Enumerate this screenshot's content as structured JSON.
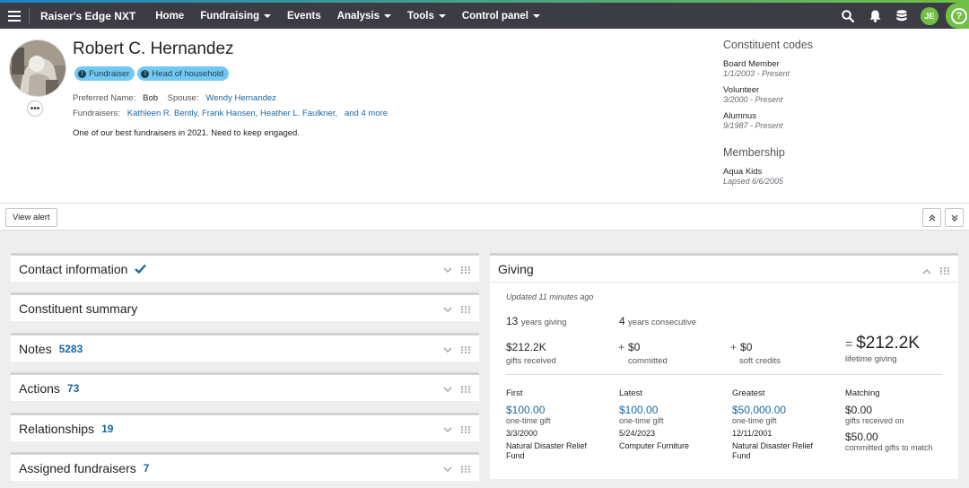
{
  "topbar": {
    "brand": "Raiser's Edge NXT",
    "nav": [
      {
        "label": "Home",
        "dropdown": false
      },
      {
        "label": "Fundraising",
        "dropdown": true
      },
      {
        "label": "Events",
        "dropdown": false
      },
      {
        "label": "Analysis",
        "dropdown": true
      },
      {
        "label": "Tools",
        "dropdown": true
      },
      {
        "label": "Control panel",
        "dropdown": true
      }
    ],
    "user_initials": "JE",
    "help_symbol": "?",
    "accent_colors": {
      "blue": "#1c84c6",
      "green": "#71bf44"
    }
  },
  "profile": {
    "name": "Robert C. Hernandez",
    "badges": [
      "Fundraiser",
      "Head of household"
    ],
    "preferred_name_label": "Preferred Name:",
    "preferred_name": "Bob",
    "spouse_label": "Spouse:",
    "spouse": "Wendy Hernandez",
    "fundraisers_label": "Fundraisers:",
    "fundraisers": [
      "Kathleen R. Bently,",
      "Frank Hansen,",
      "Heather L. Faulkner,",
      "and 4 more"
    ],
    "note": "One of our best fundraisers in 2021.  Need to keep engaged.",
    "more_button": "•••"
  },
  "constituent_codes": {
    "heading": "Constituent codes",
    "items": [
      {
        "name": "Board Member",
        "date": "1/1/2003 - Present"
      },
      {
        "name": "Volunteer",
        "date": "3/2000 - Present"
      },
      {
        "name": "Alumnus",
        "date": "9/1987 - Present"
      }
    ]
  },
  "membership": {
    "heading": "Membership",
    "name": "Aqua Kids",
    "status": "Lapsed 6/6/2005"
  },
  "alert": {
    "view_alert": "View alert"
  },
  "tiles": [
    {
      "title": "Contact information",
      "count": "",
      "check": true
    },
    {
      "title": "Constituent summary",
      "count": ""
    },
    {
      "title": "Notes",
      "count": "5283"
    },
    {
      "title": "Actions",
      "count": "73"
    },
    {
      "title": "Relationships",
      "count": "19"
    },
    {
      "title": "Assigned fundraisers",
      "count": "7"
    }
  ],
  "giving": {
    "title": "Giving",
    "updated": "Updated 11 minutes ago",
    "years_giving": "13",
    "years_giving_label": "years giving",
    "years_consecutive": "4",
    "years_consecutive_label": "years consecutive",
    "gifts_received": "$212.2K",
    "gifts_received_label": "gifts received",
    "committed": "$0",
    "committed_label": "committed",
    "soft_credits": "$0",
    "soft_credits_label": "soft credits",
    "lifetime": "$212.2K",
    "lifetime_label": "lifetime giving",
    "plus": "+",
    "equals": "=",
    "first": {
      "heading": "First",
      "amount": "$100.00",
      "type": "one-time gift",
      "date": "3/3/2000",
      "fund": "Natural Disaster Relief Fund"
    },
    "latest": {
      "heading": "Latest",
      "amount": "$100.00",
      "type": "one-time gift",
      "date": "5/24/2023",
      "fund": "Computer Furniture"
    },
    "greatest": {
      "heading": "Greatest",
      "amount": "$50,000.00",
      "type": "one-time gift",
      "date": "12/11/2001",
      "fund": "Natural Disaster Relief Fund"
    },
    "matching": {
      "heading": "Matching",
      "received": "$0.00",
      "received_label": "gifts received on",
      "committed": "$50.00",
      "committed_label": "committed gifts to match"
    }
  }
}
